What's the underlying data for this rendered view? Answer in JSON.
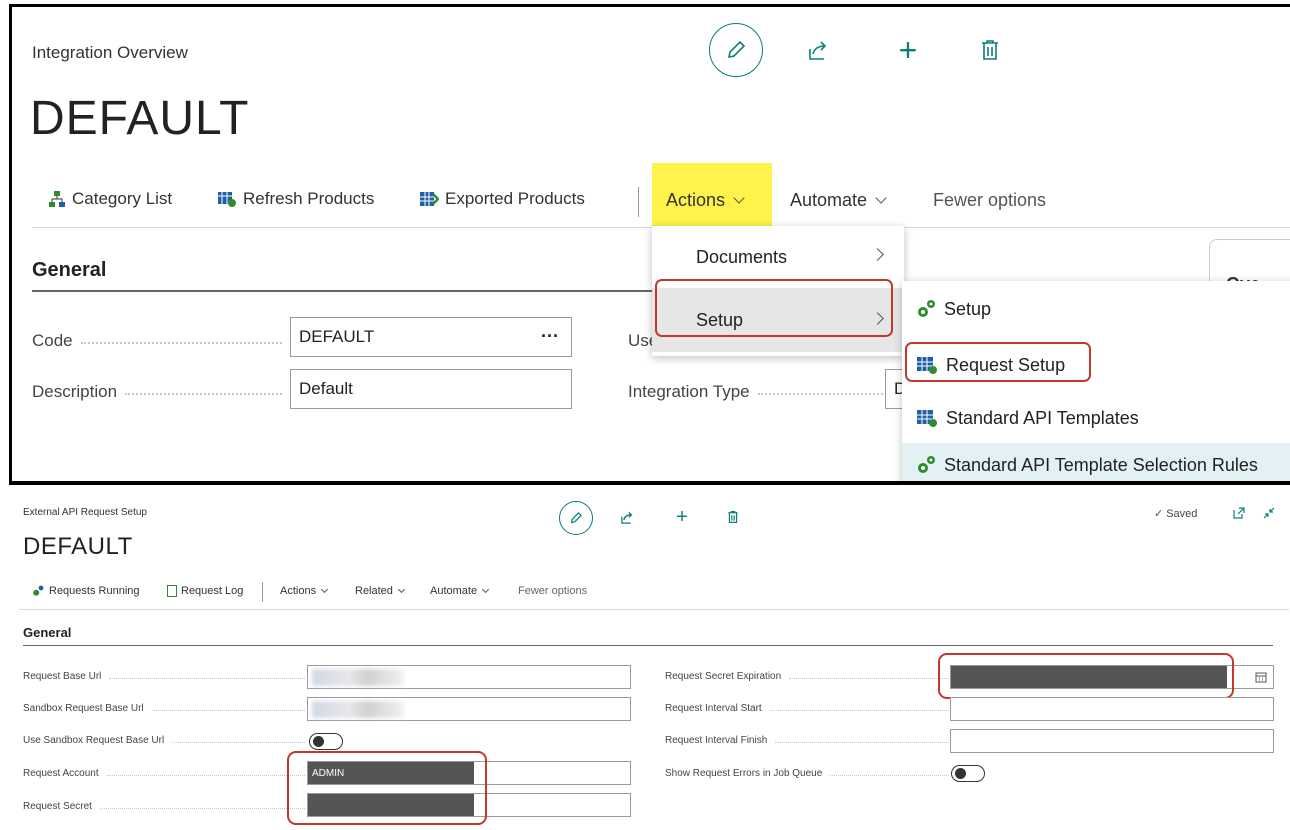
{
  "top_page": {
    "breadcrumb": "Integration Overview",
    "title": "DEFAULT",
    "toolbar": {
      "category_list": "Category List",
      "refresh_products": "Refresh Products",
      "exported_products": "Exported Products",
      "actions": "Actions",
      "automate": "Automate",
      "fewer_options": "Fewer options"
    },
    "section_title": "General",
    "fields": {
      "code_label": "Code",
      "code_value": "DEFAULT",
      "code_ellipsis": "···",
      "description_label": "Description",
      "description_value": "Default",
      "user_setup_label": "User Setup ID",
      "integration_type_label": "Integration Type",
      "integration_type_value": "D"
    },
    "actions_menu": {
      "documents": "Documents",
      "setup": "Setup"
    },
    "setup_submenu": {
      "setup": "Setup",
      "request_setup": "Request Setup",
      "standard_api_templates": "Standard API Templates",
      "selection_rules": "Standard API Template Selection Rules"
    },
    "factbox_partial": "Ove"
  },
  "bottom_page": {
    "breadcrumb": "External API Request Setup",
    "title": "DEFAULT",
    "saved_status": "Saved",
    "toolbar": {
      "requests_running": "Requests Running",
      "request_log": "Request Log",
      "actions": "Actions",
      "related": "Related",
      "automate": "Automate",
      "fewer_options": "Fewer options"
    },
    "section_title": "General",
    "left_fields": {
      "request_base_url": "Request Base Url",
      "sandbox_request_base_url": "Sandbox Request Base Url",
      "use_sandbox_request_base_url": "Use Sandbox Request Base Url",
      "request_account": "Request Account",
      "request_account_value": "ADMIN",
      "request_secret": "Request Secret"
    },
    "right_fields": {
      "request_secret_expiration": "Request Secret Expiration",
      "request_interval_start": "Request Interval Start",
      "request_interval_finish": "Request Interval Finish",
      "show_request_errors": "Show Request Errors in Job Queue"
    }
  },
  "colors": {
    "accent_teal": "#0a7f7a",
    "highlight_yellow": "#fff24a",
    "annotation_red": "#c0392b",
    "redaction_gray": "#555555"
  }
}
